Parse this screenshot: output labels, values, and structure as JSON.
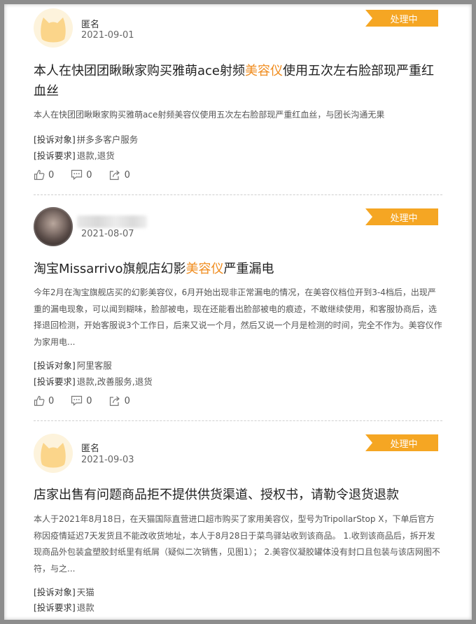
{
  "status_color": "#f5a623",
  "highlight_color": "#f08c1e",
  "posts": [
    {
      "author": "匿名",
      "date": "2021-09-01",
      "status": "处理中",
      "title_pre": "本人在快团团瞅瞅家购买雅萌ace射频",
      "title_hl": "美容仪",
      "title_post": "使用五次左右脸部现严重红血丝",
      "description": "本人在快团团瞅瞅家购买雅萌ace射频美容仪使用五次左右脸部现严重红血丝，与团长沟通无果",
      "target_label": "[投诉对象]",
      "target_value": "拼多多客户服务",
      "demand_label": "[投诉要求]",
      "demand_value": "退款,退货",
      "likes": "0",
      "comments": "0",
      "shares": "0"
    },
    {
      "author": "",
      "date": "2021-08-07",
      "status": "处理中",
      "title_pre": "淘宝Missarrivo旗舰店幻影",
      "title_hl": "美容仪",
      "title_post": "严重漏电",
      "description": "今年2月在淘宝旗舰店买的幻影美容仪，6月开始出现非正常漏电的情况，在美容仪档位开到3-4档后，出现严重的漏电现象，可以闻到糊味，脸部被电，现在还能看出脸部被电的痕迹，不敢继续使用，和客服协商后，选择退回检测，开始客服说3个工作日，后来又说一个月，然后又说一个月是检测的时间，完全不作为。美容仪作为家用电...",
      "target_label": "[投诉对象]",
      "target_value": "阿里客服",
      "demand_label": "[投诉要求]",
      "demand_value": "退款,改善服务,退货",
      "likes": "0",
      "comments": "0",
      "shares": "0"
    },
    {
      "author": "匿名",
      "date": "2021-09-03",
      "status": "处理中",
      "title_pre": "店家出售有问题商品拒不提供供货渠道、授权书，请勒令退货退款",
      "title_hl": "",
      "title_post": "",
      "description": "本人于2021年8月18日，在天猫国际直营进口超市购买了家用美容仪，型号为TripollarStop X，下单后官方称因疫情延迟7天发货且不能改收货地址，本人于8月28日于菜鸟驿站收到该商品。 1.收到该商品后，拆开发现商品外包装盒塑胶封纸里有纸屑（疑似二次销售，见图1）； 2.美容仪凝胶罐体没有封口且包装与该店网图不符，与之...",
      "target_label": "[投诉对象]",
      "target_value": "天猫",
      "demand_label": "[投诉要求]",
      "demand_value": "退款",
      "likes": "0",
      "comments": "0",
      "shares": "0"
    }
  ]
}
